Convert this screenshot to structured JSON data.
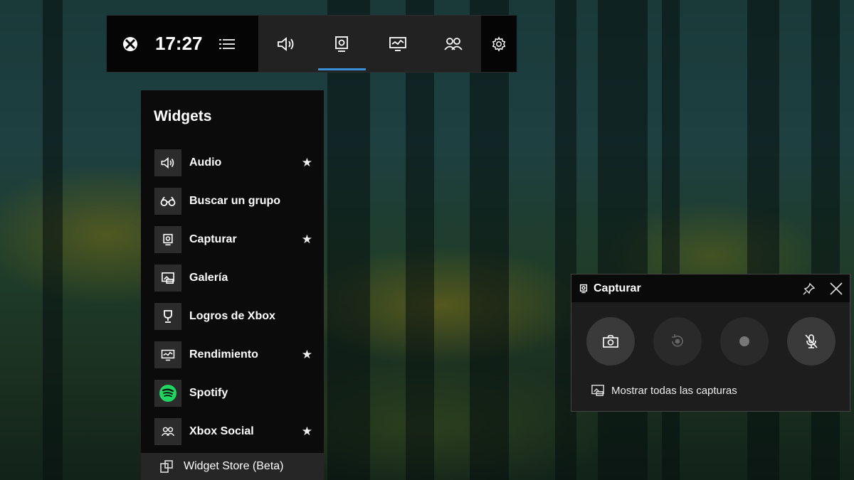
{
  "gamebar": {
    "time": "17:27",
    "icons": [
      "xbox-logo-icon",
      "menu-icon",
      "audio-icon",
      "capture-icon",
      "performance-icon",
      "xbox-social-icon",
      "settings-icon"
    ]
  },
  "widgets": {
    "title": "Widgets",
    "items": [
      {
        "label": "Audio",
        "icon": "speaker-icon",
        "favorite": true
      },
      {
        "label": "Buscar un grupo",
        "icon": "binoculars-icon",
        "favorite": false
      },
      {
        "label": "Capturar",
        "icon": "capture-icon",
        "favorite": true
      },
      {
        "label": "Galería",
        "icon": "gallery-icon",
        "favorite": false
      },
      {
        "label": "Logros de Xbox",
        "icon": "trophy-icon",
        "favorite": false
      },
      {
        "label": "Rendimiento",
        "icon": "performance-icon",
        "favorite": true
      },
      {
        "label": "Spotify",
        "icon": "spotify-icon",
        "favorite": false
      },
      {
        "label": "Xbox Social",
        "icon": "people-icon",
        "favorite": true
      }
    ],
    "favorite_glyph": "★",
    "store_label": "Widget Store (Beta)"
  },
  "capture": {
    "title": "Capturar",
    "buttons": [
      "camera-icon",
      "record-last-icon",
      "record-icon",
      "mic-off-icon"
    ],
    "show_all_label": "Mostrar todas las capturas"
  },
  "colors": {
    "accent": "#3a8fdb",
    "spotify": "#1ed760"
  }
}
